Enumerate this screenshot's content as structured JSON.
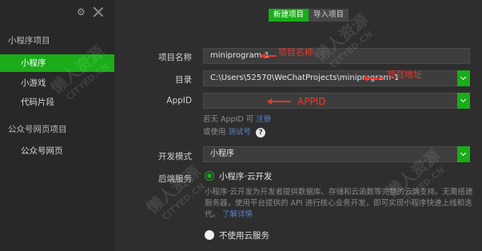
{
  "sidebar": {
    "section1_title": "小程序项目",
    "items1": [
      "小程序",
      "小游戏",
      "代码片段"
    ],
    "section2_title": "公众号网页项目",
    "items2": [
      "公众号网页"
    ]
  },
  "tabs": [
    "新建项目",
    "导入项目"
  ],
  "form": {
    "name_label": "项目名称",
    "name_value": "miniprogram-1",
    "dir_label": "目录",
    "dir_value": "C:\\Users\\52570\\WeChatProjects\\miniprogram-1",
    "appid_label": "AppID",
    "appid_value": "",
    "hint1_text": "若无 AppID 可",
    "hint1_link": "注册",
    "hint2_text": "或使用",
    "hint2_link": "测试号",
    "help_symbol": "?",
    "mode_label": "开发模式",
    "mode_value": "小程序",
    "backend_label": "后端服务",
    "radio1_label": "小程序·云开发",
    "desc_text": "小程序·云开发为开发者提供数据库、存储和云函数等完整的云端支持。无需搭建服务器，使用平台提供的 API 进行核心业务开发，即可实现小程序快速上线和迭代。",
    "desc_link": "了解详情",
    "radio2_label": "不使用云服务"
  },
  "annotations": {
    "name": "项目名称",
    "dir": "项目地址",
    "appid": "APPID"
  },
  "watermark": {
    "big": "懒人资源",
    "small": "CITYED.CN"
  },
  "colors": {
    "accent": "#1aad19",
    "annotation": "#e8372b"
  }
}
